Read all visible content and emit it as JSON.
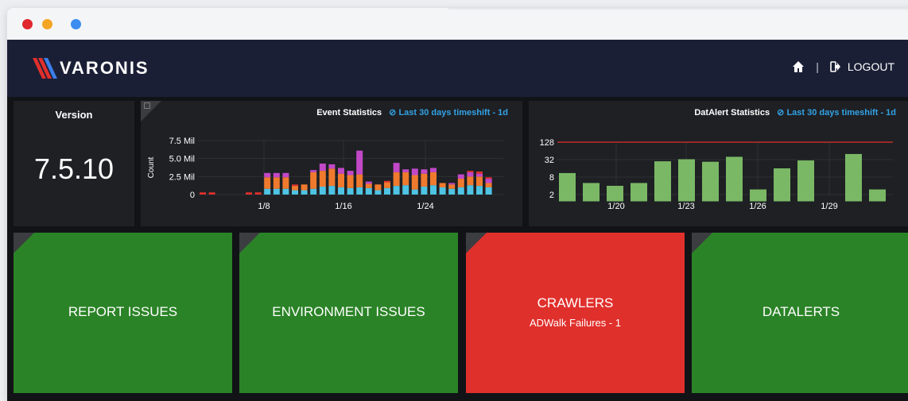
{
  "window": {
    "controls": [
      "close",
      "minimize",
      "maximize"
    ]
  },
  "navbar": {
    "logo_text": "VARONIS",
    "home_icon": "home-icon",
    "separator": "|",
    "logout_label": "LOGOUT",
    "logout_icon": "logout-icon"
  },
  "version_panel": {
    "label": "Version",
    "value": "7.5.10"
  },
  "event_chart": {
    "title": "Event Statistics",
    "timeshift_label": "Last 30 days timeshift - 1d"
  },
  "datalert_chart": {
    "title": "DatAlert Statistics",
    "timeshift_label": "Last 30 days timeshift - 1d"
  },
  "tiles": [
    {
      "title": "REPORT ISSUES",
      "subtitle": "",
      "color": "#2b8327"
    },
    {
      "title": "ENVIRONMENT ISSUES",
      "subtitle": "",
      "color": "#2b8327"
    },
    {
      "title": "CRAWLERS",
      "subtitle": "ADWalk Failures - 1",
      "color": "#e0302c"
    },
    {
      "title": "DATALERTS",
      "subtitle": "",
      "color": "#2b8327"
    }
  ],
  "chart_data": [
    {
      "type": "bar",
      "stacked": true,
      "ylabel": "Count",
      "y_ticks": [
        "0",
        "2.5 Mil",
        "5.0 Mil",
        "7.5 Mil"
      ],
      "ylim": [
        0,
        7500000
      ],
      "x_ticks": [
        "1/8",
        "1/16",
        "1/24"
      ],
      "colors": {
        "cyan": "#4fc3e3",
        "orange": "#ef7a2e",
        "magenta": "#c248c8",
        "red": "#e0302c",
        "yellow": "#f0b429"
      },
      "series": [
        {
          "name": "",
          "color": "#4fc3e3",
          "values": [
            0,
            0,
            0,
            0,
            0,
            0,
            0,
            0,
            0,
            0,
            0,
            0,
            0,
            0,
            0,
            0,
            0,
            0,
            0,
            0,
            0,
            0,
            0,
            0,
            0,
            0,
            0,
            0,
            0,
            0,
            0,
            0,
            0,
            0,
            0,
            0,
            0,
            0,
            0,
            0,
            0,
            0,
            0,
            0,
            0,
            0,
            0,
            0
          ]
        },
        {
          "name": "",
          "color": "#ef7a2e",
          "values": []
        },
        {
          "name": "",
          "color": "#c248c8",
          "values": []
        },
        {
          "name": "",
          "color": "#e0302c",
          "values": []
        }
      ],
      "bars": [
        [
          0,
          0,
          0,
          0.3
        ],
        [
          0,
          0,
          0,
          0.3
        ],
        [
          0,
          0,
          0,
          0
        ],
        [
          0,
          0,
          0,
          0
        ],
        [
          0,
          0,
          0,
          0
        ],
        [
          0,
          0,
          0,
          0.3
        ],
        [
          0,
          0,
          0,
          0.3
        ],
        [
          0.8,
          1.6,
          0.6,
          0
        ],
        [
          0.8,
          1.6,
          0.6,
          0
        ],
        [
          0.8,
          1.6,
          0.6,
          0
        ],
        [
          0.6,
          0.6,
          0,
          0.2
        ],
        [
          0.6,
          0.8,
          0,
          0
        ],
        [
          0.8,
          2.3,
          0.3,
          0
        ],
        [
          1.1,
          2.2,
          1.0,
          0
        ],
        [
          1.2,
          2.4,
          0.6,
          0
        ],
        [
          1.0,
          1.9,
          0.8,
          0
        ],
        [
          0.9,
          1.8,
          0.6,
          0
        ],
        [
          1.0,
          1.8,
          3.3,
          0
        ],
        [
          0.9,
          0.6,
          0.3,
          0
        ],
        [
          0.6,
          0.8,
          0,
          0
        ],
        [
          0.9,
          0.8,
          0,
          0.2
        ],
        [
          1.2,
          1.9,
          1.3,
          0
        ],
        [
          1.3,
          1.8,
          0.4,
          0
        ],
        [
          0.7,
          2.0,
          0.9,
          0
        ],
        [
          1.1,
          1.8,
          0.6,
          0
        ],
        [
          1.3,
          1.8,
          0.6,
          0
        ],
        [
          1.0,
          0.6,
          0,
          0
        ],
        [
          0.8,
          0.6,
          0.2,
          0
        ],
        [
          1.0,
          1.2,
          0.6,
          0
        ],
        [
          1.3,
          1.2,
          0.6,
          0.2
        ],
        [
          1.2,
          1.3,
          0.4,
          0.3
        ],
        [
          1.0,
          0.6,
          0.6,
          0.2
        ]
      ]
    },
    {
      "type": "bar",
      "scale": "log2",
      "y_ticks": [
        "2",
        "8",
        "32",
        "128"
      ],
      "x_ticks": [
        "1/20",
        "1/23",
        "1/26",
        "1/29"
      ],
      "threshold": 128,
      "threshold_color": "#e0302c",
      "bar_color": "#7ab865",
      "values": [
        11,
        5,
        4,
        5,
        28,
        33,
        27,
        40,
        3,
        16,
        30,
        0,
        50,
        3
      ]
    }
  ]
}
